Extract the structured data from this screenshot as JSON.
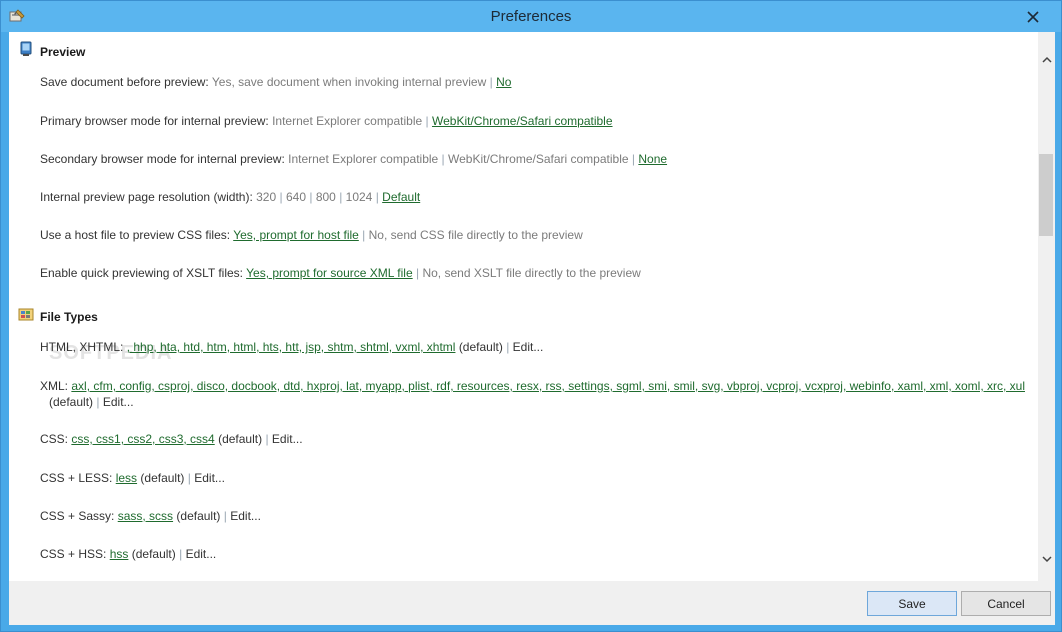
{
  "window": {
    "title": "Preferences"
  },
  "watermark": "SOFTPEDIA",
  "sections": {
    "preview": {
      "title": "Preview",
      "save_doc": {
        "label": "Save document before preview:",
        "opt1": "Yes, save document when invoking internal preview",
        "opt2": "No"
      },
      "primary_browser": {
        "label": "Primary browser mode for internal preview:",
        "opt1": "Internet Explorer compatible",
        "opt2": "WebKit/Chrome/Safari compatible"
      },
      "secondary_browser": {
        "label": "Secondary browser mode for internal preview:",
        "opt1": "Internet Explorer compatible",
        "opt2": "WebKit/Chrome/Safari compatible",
        "opt3": "None"
      },
      "resolution": {
        "label": "Internal preview page resolution (width):",
        "opt1": "320",
        "opt2": "640",
        "opt3": "800",
        "opt4": "1024",
        "opt5": "Default"
      },
      "host_file": {
        "label": "Use a host file to preview CSS files:",
        "opt1": "Yes, prompt for host file",
        "opt2": "No, send CSS file directly to the preview"
      },
      "xslt": {
        "label": "Enable quick previewing of XSLT files:",
        "opt1": "Yes, prompt for source XML file",
        "opt2": "No, send XSLT file directly to the preview"
      }
    },
    "file_types": {
      "title": "File Types",
      "html": {
        "label": "HTML, XHTML:",
        "exts": ", hhp, hta, htd, htm, html, hts, htt, jsp, shtm, shtml, vxml, xhtml",
        "default": "(default)",
        "edit": "Edit..."
      },
      "xml": {
        "label": "XML:",
        "exts": "axl, cfm, config, csproj, disco, docbook, dtd, hxproj, lat, myapp, plist, rdf, resources, resx, rss, settings, sgml, smi, smil, svg, vbproj, vcproj, vcxproj, webinfo, xaml, xml, xoml, xrc, xul",
        "default": "(default)",
        "edit": "Edit..."
      },
      "css": {
        "label": "CSS:",
        "exts": "css, css1, css2, css3, css4",
        "default": "(default)",
        "edit": "Edit..."
      },
      "less": {
        "label": "CSS + LESS:",
        "exts": "less",
        "default": "(default)",
        "edit": "Edit..."
      },
      "sassy": {
        "label": "CSS + Sassy:",
        "exts": "sass, scss",
        "default": "(default)",
        "edit": "Edit..."
      },
      "hss": {
        "label": "CSS + HSS:",
        "exts": "hss",
        "default": "(default)",
        "edit": "Edit..."
      }
    }
  },
  "footer": {
    "save": "Save",
    "cancel": "Cancel"
  },
  "separator": "|",
  "colors": {
    "selected_link": "#1f6b2e",
    "unselected": "#7b7b7b",
    "titlebar": "#5ab5ef"
  }
}
